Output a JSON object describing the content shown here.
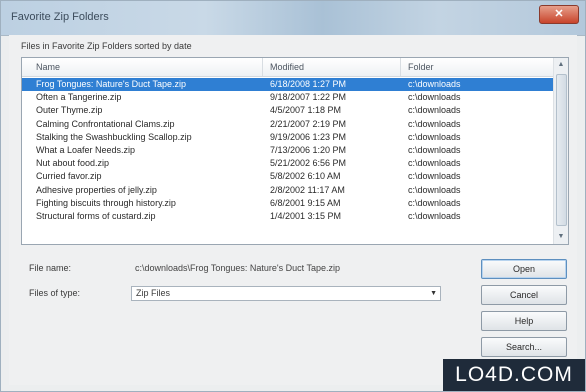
{
  "window": {
    "title": "Favorite Zip Folders",
    "close_glyph": "✕"
  },
  "list": {
    "caption": "Files in Favorite Zip Folders sorted by date",
    "columns": [
      "Name",
      "Modified",
      "Folder"
    ],
    "rows": [
      {
        "name": "Frog Tongues: Nature's Duct Tape.zip",
        "modified": "6/18/2008 1:27 PM",
        "folder": "c:\\downloads",
        "selected": true
      },
      {
        "name": "Often a Tangerine.zip",
        "modified": "9/18/2007 1:22 PM",
        "folder": "c:\\downloads"
      },
      {
        "name": "Outer Thyme.zip",
        "modified": "4/5/2007 1:18 PM",
        "folder": "c:\\downloads"
      },
      {
        "name": "Calming Confrontational Clams.zip",
        "modified": "2/21/2007 2:19 PM",
        "folder": "c:\\downloads"
      },
      {
        "name": "Stalking the Swashbuckling Scallop.zip",
        "modified": "9/19/2006 1:23 PM",
        "folder": "c:\\downloads"
      },
      {
        "name": "What a Loafer Needs.zip",
        "modified": "7/13/2006 1:20 PM",
        "folder": "c:\\downloads"
      },
      {
        "name": "Nut about food.zip",
        "modified": "5/21/2002 6:56 PM",
        "folder": "c:\\downloads"
      },
      {
        "name": "Curried favor.zip",
        "modified": "5/8/2002 6:10 AM",
        "folder": "c:\\downloads"
      },
      {
        "name": "Adhesive properties of jelly.zip",
        "modified": "2/8/2002 11:17 AM",
        "folder": "c:\\downloads"
      },
      {
        "name": "Fighting biscuits through history.zip",
        "modified": "6/8/2001 9:15 AM",
        "folder": "c:\\downloads"
      },
      {
        "name": "Structural forms of custard.zip",
        "modified": "1/4/2001 3:15 PM",
        "folder": "c:\\downloads"
      }
    ]
  },
  "form": {
    "file_name_label": "File name:",
    "file_name_value": "c:\\downloads\\Frog Tongues: Nature's Duct Tape.zip",
    "file_type_label": "Files of type:",
    "file_type_value": "Zip Files"
  },
  "buttons": {
    "open": "Open",
    "cancel": "Cancel",
    "help": "Help",
    "search": "Search..."
  },
  "watermark": "LO4D.COM",
  "icons": {
    "scroll_up": "▲",
    "scroll_down": "▼",
    "dropdown": "▼"
  }
}
